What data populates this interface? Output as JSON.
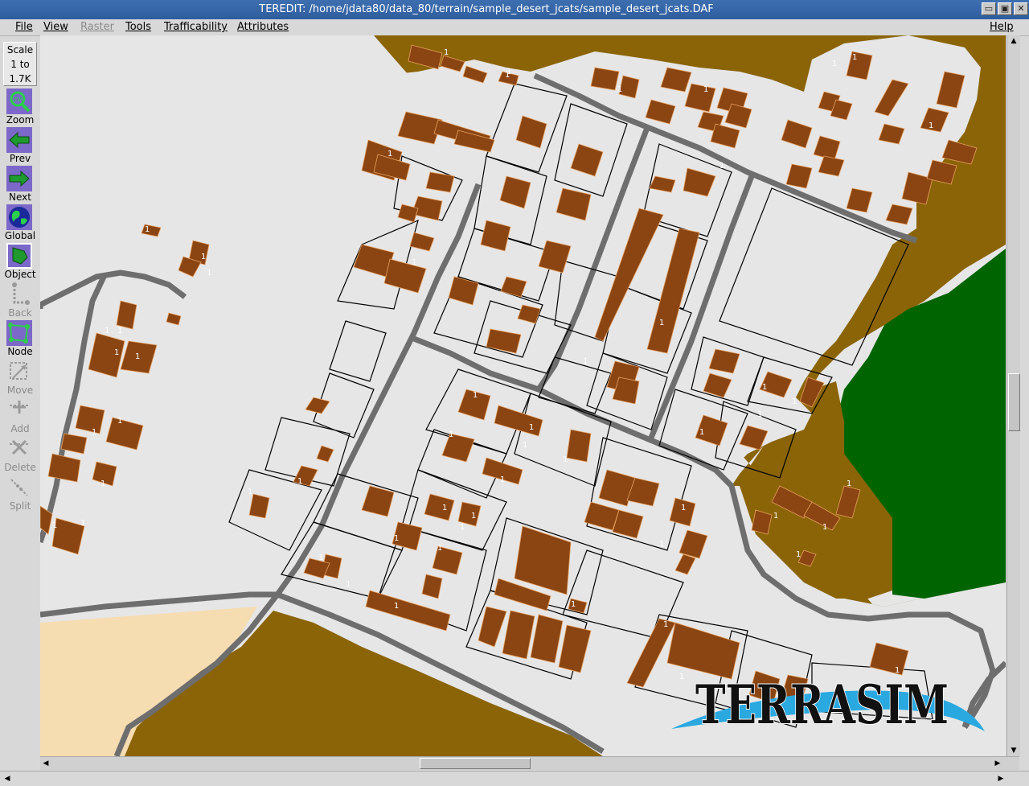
{
  "window": {
    "title": "TEREDIT: /home/jdata80/data_80/terrain/sample_desert_jcats/sample_desert_jcats.DAF",
    "buttons": [
      "▭",
      "▣",
      "✕"
    ]
  },
  "menubar": {
    "items": [
      {
        "label": "File",
        "enabled": true
      },
      {
        "label": "View",
        "enabled": true
      },
      {
        "label": "Raster",
        "enabled": false
      },
      {
        "label": "Tools",
        "enabled": true
      },
      {
        "label": "Trafficability",
        "enabled": true
      },
      {
        "label": "Attributes",
        "enabled": true
      }
    ],
    "help": "Help"
  },
  "toolbar": {
    "scale": {
      "line1": "Scale",
      "line2": "1 to",
      "line3": "1.7K"
    },
    "tools": [
      {
        "label": "Zoom",
        "icon": "zoom-icon",
        "enabled": true
      },
      {
        "label": "Prev",
        "icon": "left-arrow-icon",
        "enabled": true
      },
      {
        "label": "Next",
        "icon": "right-arrow-icon",
        "enabled": true
      },
      {
        "label": "Global",
        "icon": "globe-icon",
        "enabled": true
      },
      {
        "label": "Object",
        "icon": "object-select-icon",
        "enabled": true,
        "active": true
      },
      {
        "label": "Back",
        "icon": "back-icon",
        "enabled": false
      },
      {
        "label": "Node",
        "icon": "node-icon",
        "enabled": true
      },
      {
        "label": "Move",
        "icon": "move-icon",
        "enabled": false
      },
      {
        "label": "Add",
        "icon": "add-node-icon",
        "enabled": false
      },
      {
        "label": "Delete",
        "icon": "delete-node-icon",
        "enabled": false
      },
      {
        "label": "Split",
        "icon": "split-icon",
        "enabled": false
      }
    ]
  },
  "map": {
    "logo": "TERRASIM",
    "building_label": "1",
    "colors": {
      "ground": "#e6e6e6",
      "sand": "#f6dcb1",
      "vegetation": "#006400",
      "dirt": "#8b6408",
      "building": "#8a4512",
      "road": "#6e6e6e",
      "lot_line": "#000000"
    }
  }
}
